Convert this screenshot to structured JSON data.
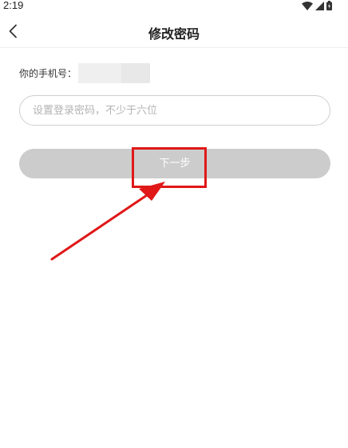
{
  "status_bar": {
    "time": "2:19",
    "icons": [
      "wifi-icon",
      "cellular-signal-icon",
      "battery-icon"
    ]
  },
  "header": {
    "back_icon": "chevron-left-icon",
    "title": "修改密码"
  },
  "form": {
    "phone_label": "你的手机号：",
    "password_placeholder": "设置登录密码，不少于六位",
    "password_value": ""
  },
  "next_button": {
    "label": "下一步",
    "state": "disabled"
  },
  "colors": {
    "button_disabled": "#cccccc",
    "annotation": "#e01818",
    "input_border": "#cfcfcf",
    "placeholder": "#b3b3b3"
  }
}
